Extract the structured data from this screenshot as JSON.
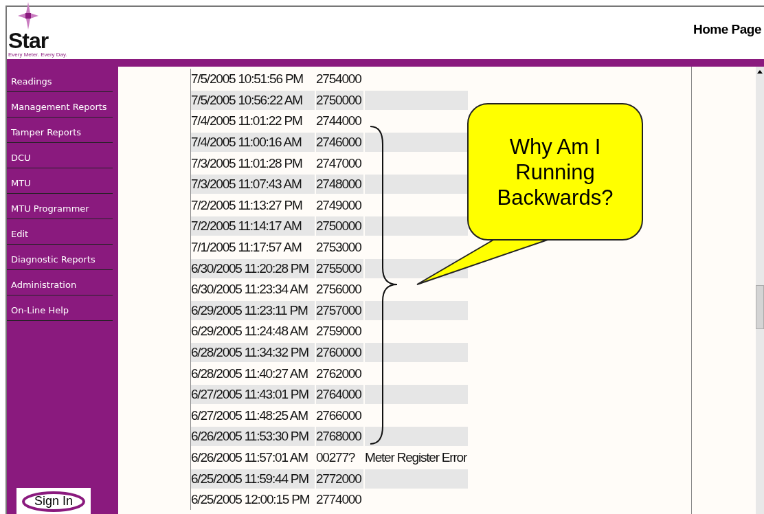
{
  "header": {
    "logo": "Star",
    "tagline": "Every Meter. Every Day.",
    "title": "Home Page"
  },
  "sidebar": {
    "items": [
      "Readings",
      "Management Reports",
      "Tamper Reports",
      "DCU",
      "MTU",
      "MTU Programmer",
      "Edit",
      "Diagnostic Reports",
      "Administration",
      "On-Line Help"
    ],
    "sign_in": "Sign In"
  },
  "table": {
    "rows": [
      [
        "7/5/2005 10:51:56 PM",
        "2754000"
      ],
      [
        "7/5/2005 10:56:22 AM",
        "2750000",
        ""
      ],
      [
        "7/4/2005 11:01:22 PM",
        "2744000"
      ],
      [
        "7/4/2005 11:00:16 AM",
        "2746000",
        ""
      ],
      [
        "7/3/2005 11:01:28 PM",
        "2747000"
      ],
      [
        "7/3/2005 11:07:43 AM",
        "2748000",
        ""
      ],
      [
        "7/2/2005 11:13:27 PM",
        "2749000"
      ],
      [
        "7/2/2005 11:14:17 AM",
        "2750000",
        ""
      ],
      [
        "7/1/2005 11:17:57 AM",
        "2753000"
      ],
      [
        "6/30/2005 11:20:28 PM",
        "2755000",
        ""
      ],
      [
        "6/30/2005 11:23:34 AM",
        "2756000"
      ],
      [
        "6/29/2005 11:23:11 PM",
        "2757000",
        ""
      ],
      [
        "6/29/2005 11:24:48 AM",
        "2759000"
      ],
      [
        "6/28/2005 11:34:32 PM",
        "2760000",
        ""
      ],
      [
        "6/28/2005 11:40:27 AM",
        "2762000"
      ],
      [
        "6/27/2005 11:43:01 PM",
        "2764000",
        ""
      ],
      [
        "6/27/2005 11:48:25 AM",
        "2766000"
      ],
      [
        "6/26/2005 11:53:30 PM",
        "2768000",
        ""
      ],
      [
        "6/26/2005 11:57:01 AM",
        "00277?",
        "Meter Register Error"
      ],
      [
        "6/25/2005 11:59:44 PM",
        "2772000",
        ""
      ],
      [
        "6/25/2005 12:00:15 PM",
        "2774000"
      ]
    ]
  },
  "callout": {
    "text": "Why Am I Running Backwards?"
  }
}
